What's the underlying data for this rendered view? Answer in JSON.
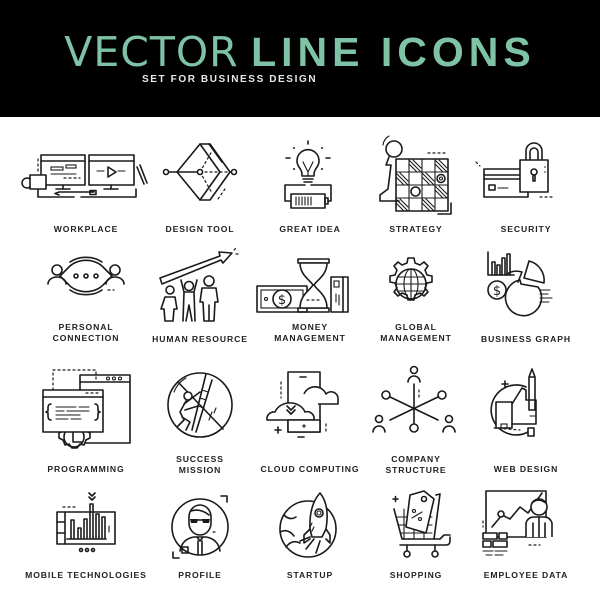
{
  "header": {
    "title_light": "VECTOR",
    "title_bold": "LINE ICONS",
    "subtitle": "SET FOR BUSINESS DESIGN",
    "background": "#000000",
    "accent": "#7fc3a6"
  },
  "icons": [
    {
      "icon": "workplace-icon",
      "label": "WORKPLACE"
    },
    {
      "icon": "design-tool-icon",
      "label": "DESIGN TOOL"
    },
    {
      "icon": "great-idea-icon",
      "label": "GREAT IDEA"
    },
    {
      "icon": "strategy-icon",
      "label": "STRATEGY"
    },
    {
      "icon": "security-icon",
      "label": "SECURITY"
    },
    {
      "icon": "personal-connection-icon",
      "label_line1": "PERSONAL",
      "label_line2": "CONNECTION"
    },
    {
      "icon": "human-resource-icon",
      "label": "HUMAN RESOURCE"
    },
    {
      "icon": "money-management-icon",
      "label_line1": "MONEY",
      "label_line2": "MANAGEMENT"
    },
    {
      "icon": "global-management-icon",
      "label_line1": "GLOBAL",
      "label_line2": "MANAGEMENT"
    },
    {
      "icon": "business-graph-icon",
      "label": "BUSINESS GRAPH"
    },
    {
      "icon": "programming-icon",
      "label": "PROGRAMMING"
    },
    {
      "icon": "success-mission-icon",
      "label_line1": "SUCCESS",
      "label_line2": "MISSION"
    },
    {
      "icon": "cloud-computing-icon",
      "label": "CLOUD COMPUTING"
    },
    {
      "icon": "company-structure-icon",
      "label_line1": "COMPANY",
      "label_line2": "STRUCTURE"
    },
    {
      "icon": "web-design-icon",
      "label": "WEB DESIGN"
    },
    {
      "icon": "mobile-technologies-icon",
      "label": "MOBILE TECHNOLOGIES"
    },
    {
      "icon": "profile-icon",
      "label": "PROFILE"
    },
    {
      "icon": "startup-icon",
      "label": "STARTUP"
    },
    {
      "icon": "shopping-icon",
      "label": "SHOPPING"
    },
    {
      "icon": "employee-data-icon",
      "label": "EMPLOYEE DATA"
    }
  ]
}
